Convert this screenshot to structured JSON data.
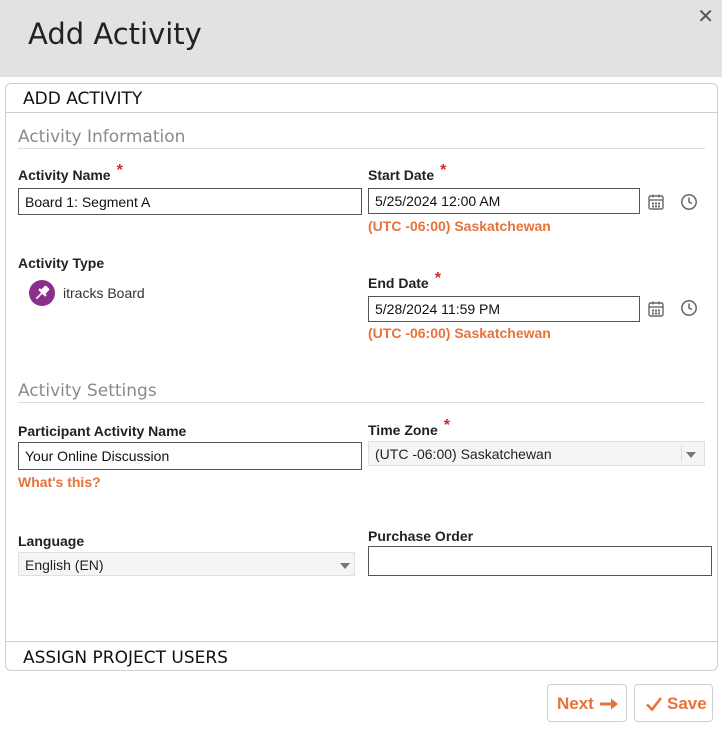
{
  "dialog": {
    "title": "Add Activity",
    "close_symbol": "✕"
  },
  "panel": {
    "header": "ADD ACTIVITY",
    "footer": "ASSIGN PROJECT USERS"
  },
  "activity_information": {
    "section_title": "Activity Information",
    "activity_name_label": "Activity Name",
    "activity_name_value": "Board 1: Segment A",
    "start_date_label": "Start Date",
    "start_date_value": "5/25/2024 12:00 AM",
    "start_tz": "(UTC -06:00) Saskatchewan",
    "activity_type_label": "Activity Type",
    "activity_type_value": "itracks Board",
    "end_date_label": "End Date",
    "end_date_value": "5/28/2024 11:59 PM",
    "end_tz": "(UTC -06:00) Saskatchewan",
    "required_marker": "*"
  },
  "activity_settings": {
    "section_title": "Activity Settings",
    "participant_name_label": "Participant Activity Name",
    "participant_name_value": "Your Online Discussion",
    "whats_this": "What's this?",
    "time_zone_label": "Time Zone",
    "time_zone_value": "(UTC -06:00) Saskatchewan",
    "language_label": "Language",
    "language_value": "English (EN)",
    "purchase_order_label": "Purchase Order",
    "purchase_order_value": ""
  },
  "actions": {
    "next_label": "Next",
    "save_label": "Save"
  },
  "colors": {
    "accent": "#e8723a",
    "required": "#d0282e",
    "header_bg": "#e2e2e2",
    "activity_type_icon": "#8b2f8d"
  },
  "icons": {
    "calendar": "calendar-icon",
    "clock": "clock-icon",
    "pin": "pushpin-icon",
    "arrow": "arrow-right-icon",
    "check": "check-icon"
  }
}
